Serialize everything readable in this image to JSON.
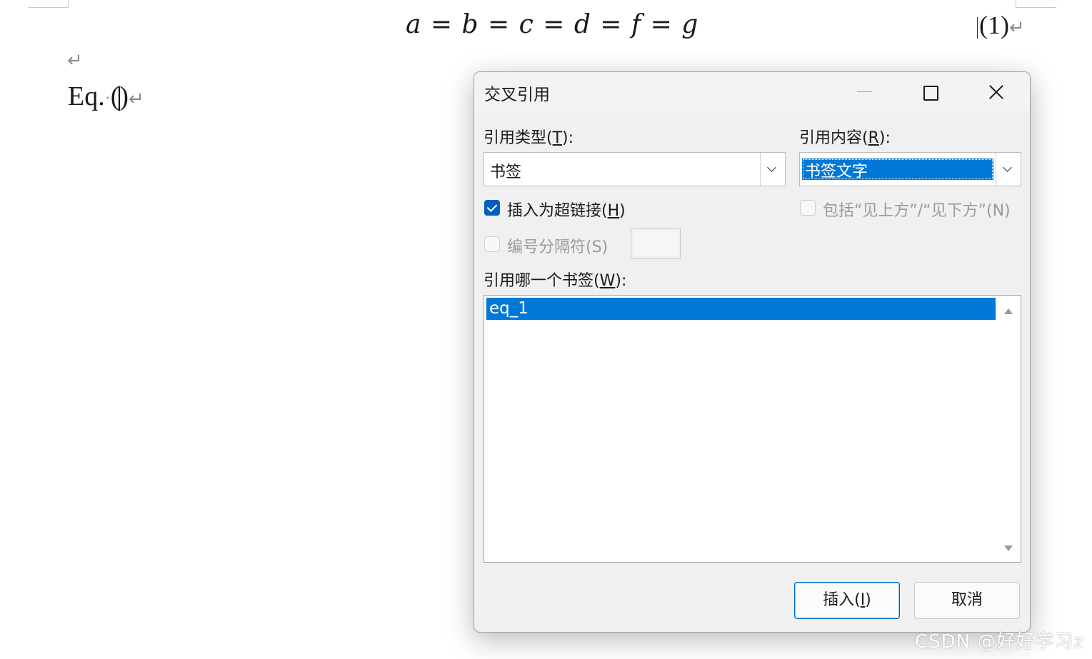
{
  "document": {
    "equation": "a = b = c = d = f = g",
    "equation_number": "(1)",
    "paragraph_mark": "↵",
    "reference_prefix": "Eq.",
    "reference_space_mark": "·",
    "reference_open": "(",
    "reference_close": ")"
  },
  "dialog": {
    "title": "交叉引用",
    "reference_type": {
      "label": "引用类型(",
      "accelerator": "T",
      "label_end": "):",
      "value": "书签"
    },
    "reference_content": {
      "label": "引用内容(",
      "accelerator": "R",
      "label_end": "):",
      "value": "书签文字"
    },
    "insert_as_hyperlink": {
      "label": "插入为超链接(",
      "accelerator": "H",
      "label_end": ")",
      "checked": true
    },
    "include_above_below": {
      "label": "包括“见上方”/“见下方”(N)",
      "checked": false,
      "enabled": false
    },
    "number_separator": {
      "label": "编号分隔符(S)",
      "checked": false,
      "enabled": false
    },
    "bookmark_list": {
      "label": "引用哪一个书签(",
      "accelerator": "W",
      "label_end": "):",
      "items": [
        "eq_1"
      ],
      "selected_index": 0
    },
    "buttons": {
      "insert_label": "插入(",
      "insert_accelerator": "I",
      "insert_label_end": ")",
      "cancel_label": "取消"
    }
  },
  "watermark": "CSDN @好好学习z",
  "colors": {
    "selection": "#0078d7",
    "checkbox_checked": "#005fb8",
    "dialog_bg": "#f0f0f0"
  }
}
